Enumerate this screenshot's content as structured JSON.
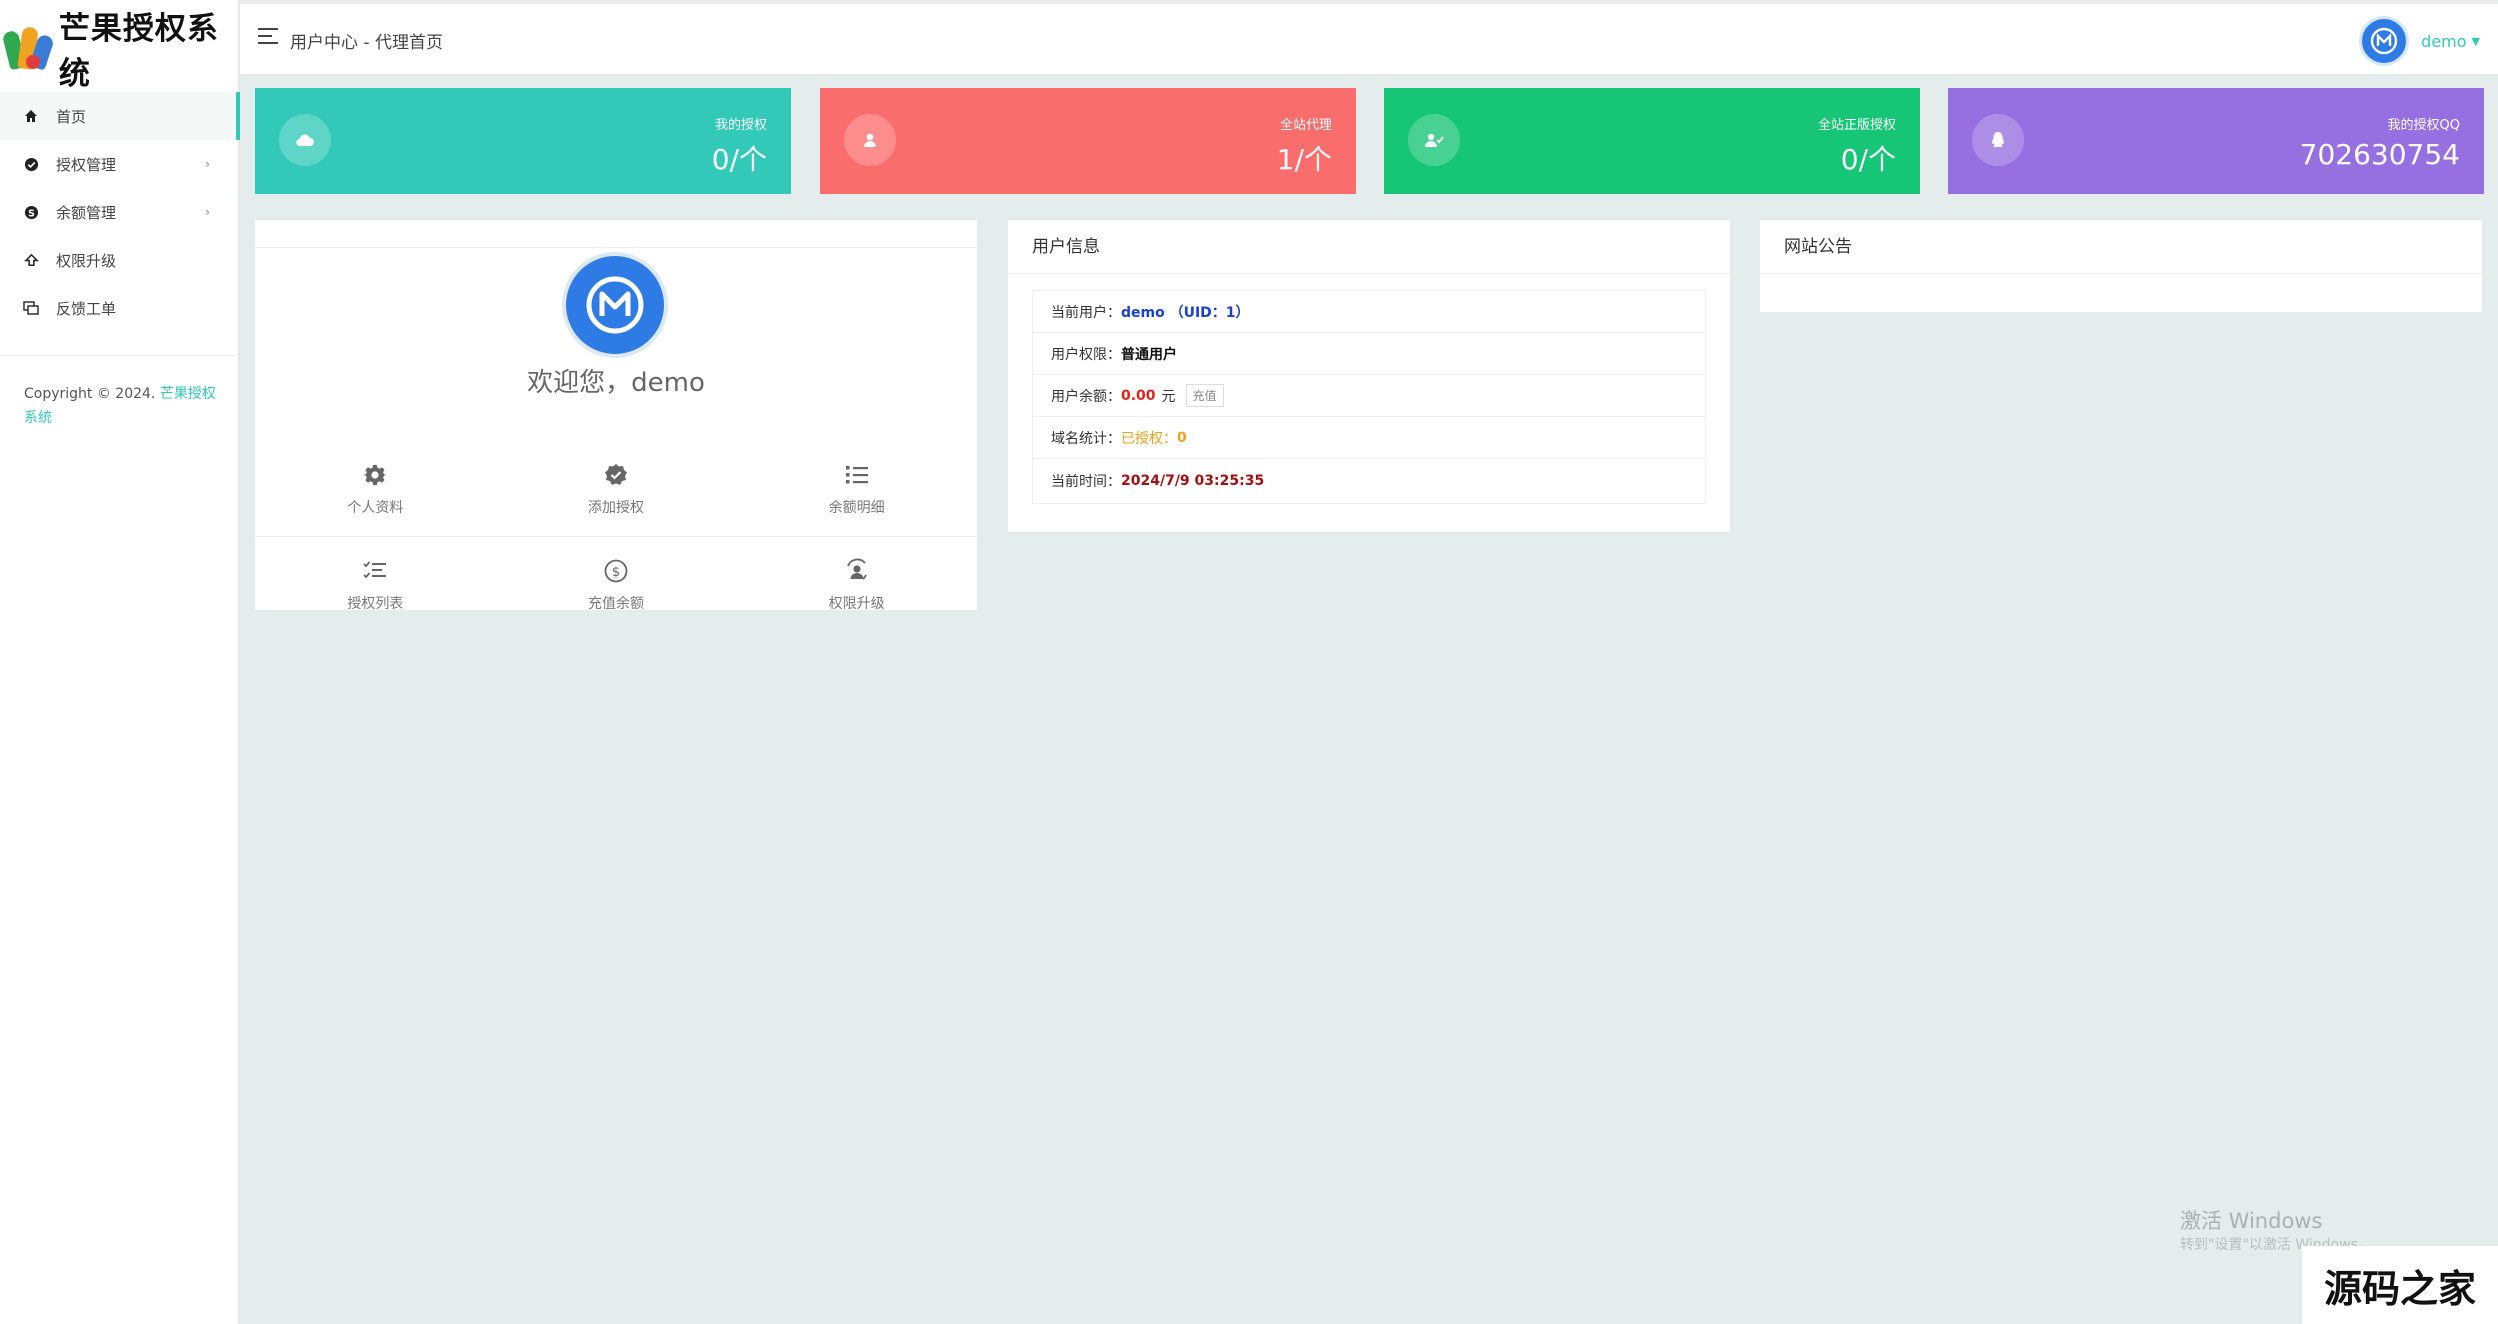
{
  "app": {
    "title": "芒果授权系统"
  },
  "header": {
    "breadcrumb": "用户中心 - 代理首页",
    "username": "demo"
  },
  "sidebar": {
    "items": [
      {
        "label": "首页",
        "icon": "home-icon",
        "active": true
      },
      {
        "label": "授权管理",
        "icon": "verified-icon",
        "has_submenu": true
      },
      {
        "label": "余额管理",
        "icon": "skype-icon",
        "has_submenu": true
      },
      {
        "label": "权限升级",
        "icon": "upgrade-icon"
      },
      {
        "label": "反馈工单",
        "icon": "ticket-icon"
      }
    ],
    "copyright_prefix": "Copyright © 2024.",
    "copyright_brand": "芒果授权系统"
  },
  "stats": [
    {
      "label": "我的授权",
      "value": "0/个",
      "color": "#33c9b9",
      "icon": "cloud-icon"
    },
    {
      "label": "全站代理",
      "value": "1/个",
      "color": "#fa6d6d",
      "icon": "user-icon"
    },
    {
      "label": "全站正版授权",
      "value": "0/个",
      "color": "#17c576",
      "icon": "user-check-icon"
    },
    {
      "label": "我的授权QQ",
      "value": "702630754",
      "color": "#966fe0",
      "icon": "qq-icon"
    }
  ],
  "profile": {
    "welcome": "欢迎您，demo",
    "quick_links": [
      {
        "label": "个人资料",
        "icon": "gear-icon"
      },
      {
        "label": "添加授权",
        "icon": "verified-badge-icon"
      },
      {
        "label": "余额明细",
        "icon": "list-icon"
      },
      {
        "label": "授权列表",
        "icon": "checklist-icon"
      },
      {
        "label": "充值余额",
        "icon": "dollar-icon"
      },
      {
        "label": "权限升级",
        "icon": "user-refresh-icon"
      }
    ]
  },
  "user_info": {
    "title": "用户信息",
    "current_user_label": "当前用户：",
    "current_user_value": "demo （UID：1）",
    "permission_label": "用户权限：",
    "permission_value": "普通用户",
    "balance_label": "用户余额：",
    "balance_value": "0.00",
    "balance_unit": "元",
    "recharge_label": "充值",
    "domain_label": "域名统计：",
    "domain_value": "已授权：",
    "domain_count": "0",
    "time_label": "当前时间：",
    "time_value": "2024/7/9 03:25:35"
  },
  "notice": {
    "title": "网站公告"
  },
  "watermarks": {
    "windows_title": "激活 Windows",
    "windows_sub": "转到\"设置\"以激活 Windows。",
    "site": "源码之家"
  }
}
